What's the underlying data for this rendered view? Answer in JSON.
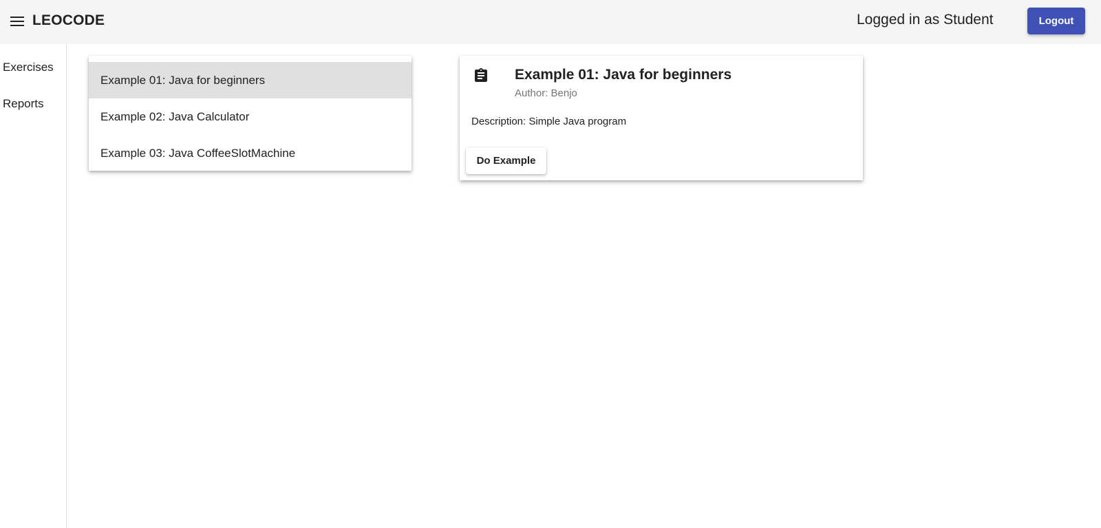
{
  "header": {
    "app_title": "LEOCODE",
    "menu_icon": "menu-icon",
    "user_status": "Logged in as Student",
    "logout_label": "Logout",
    "accent_color": "#3f51b5"
  },
  "sidebar": {
    "items": [
      {
        "label": "Exercises"
      },
      {
        "label": "Reports"
      }
    ]
  },
  "exercise_list": {
    "selected_index": 0,
    "items": [
      {
        "label": "Example 01: Java for beginners"
      },
      {
        "label": "Example 02: Java Calculator"
      },
      {
        "label": "Example 03: Java CoffeeSlotMachine"
      }
    ]
  },
  "detail": {
    "icon": "clipboard-icon",
    "title": "Example 01: Java for beginners",
    "author": "Author: Benjo",
    "description": "Description: Simple Java program",
    "action_label": "Do Example"
  }
}
